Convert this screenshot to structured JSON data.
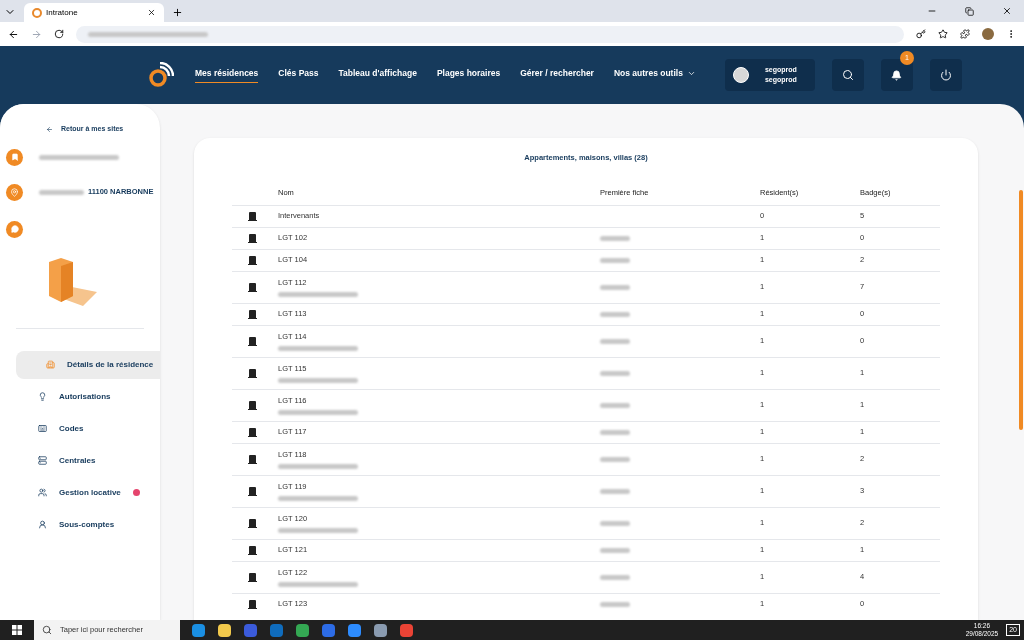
{
  "browser": {
    "tab_title": "Intratone"
  },
  "nav": {
    "items": [
      {
        "label": "Mes résidences",
        "selected": true
      },
      {
        "label": "Clés Pass",
        "selected": false
      },
      {
        "label": "Tableau d'affichage",
        "selected": false
      },
      {
        "label": "Plages horaires",
        "selected": false
      },
      {
        "label": "Gérer / rechercher",
        "selected": false
      },
      {
        "label": "Nos autres outils",
        "selected": false,
        "dropdown": true
      }
    ],
    "user": {
      "line_1": "segoprod",
      "line_2": "segoprod"
    },
    "notifications": {
      "count": "1"
    }
  },
  "sidebar": {
    "back_link": "Retour à mes sites",
    "address": "11100 NARBONNE",
    "items": [
      {
        "label": "Détails de la résidence",
        "selected": true,
        "badge": false
      },
      {
        "label": "Autorisations",
        "selected": false,
        "badge": false
      },
      {
        "label": "Codes",
        "selected": false,
        "badge": false
      },
      {
        "label": "Centrales",
        "selected": false,
        "badge": false
      },
      {
        "label": "Gestion locative",
        "selected": false,
        "badge": true
      },
      {
        "label": "Sous-comptes",
        "selected": false,
        "badge": false
      }
    ]
  },
  "table": {
    "title": "Appartements, maisons, villas (28)",
    "columns": [
      "Nom",
      "Première fiche",
      "Résident(s)",
      "Badge(s)"
    ],
    "rows": [
      {
        "name": "Intervenants",
        "note_redacted": false,
        "first_redacted": false,
        "residents": "0",
        "badges": "5"
      },
      {
        "name": "LGT 102",
        "note_redacted": false,
        "first_redacted": true,
        "residents": "1",
        "badges": "0"
      },
      {
        "name": "LGT 104",
        "note_redacted": false,
        "first_redacted": true,
        "residents": "1",
        "badges": "2"
      },
      {
        "name": "LGT 112",
        "note_redacted": true,
        "first_redacted": true,
        "residents": "1",
        "badges": "7"
      },
      {
        "name": "LGT 113",
        "note_redacted": false,
        "first_redacted": true,
        "residents": "1",
        "badges": "0"
      },
      {
        "name": "LGT 114",
        "note_redacted": true,
        "first_redacted": true,
        "residents": "1",
        "badges": "0"
      },
      {
        "name": "LGT 115",
        "note_redacted": true,
        "first_redacted": true,
        "residents": "1",
        "badges": "1"
      },
      {
        "name": "LGT 116",
        "note_redacted": true,
        "first_redacted": true,
        "residents": "1",
        "badges": "1"
      },
      {
        "name": "LGT 117",
        "note_redacted": false,
        "first_redacted": true,
        "residents": "1",
        "badges": "1"
      },
      {
        "name": "LGT 118",
        "note_redacted": true,
        "first_redacted": true,
        "residents": "1",
        "badges": "2"
      },
      {
        "name": "LGT 119",
        "note_redacted": true,
        "first_redacted": true,
        "residents": "1",
        "badges": "3"
      },
      {
        "name": "LGT 120",
        "note_redacted": true,
        "first_redacted": true,
        "residents": "1",
        "badges": "2"
      },
      {
        "name": "LGT 121",
        "note_redacted": false,
        "first_redacted": true,
        "residents": "1",
        "badges": "1"
      },
      {
        "name": "LGT 122",
        "note_redacted": true,
        "first_redacted": true,
        "residents": "1",
        "badges": "4"
      },
      {
        "name": "LGT 123",
        "note_redacted": false,
        "first_redacted": true,
        "residents": "1",
        "badges": "0"
      }
    ]
  },
  "taskbar": {
    "search_placeholder": "Taper ici pour rechercher",
    "time": "16:26",
    "date": "29/08/2025",
    "notification_count": "20"
  }
}
